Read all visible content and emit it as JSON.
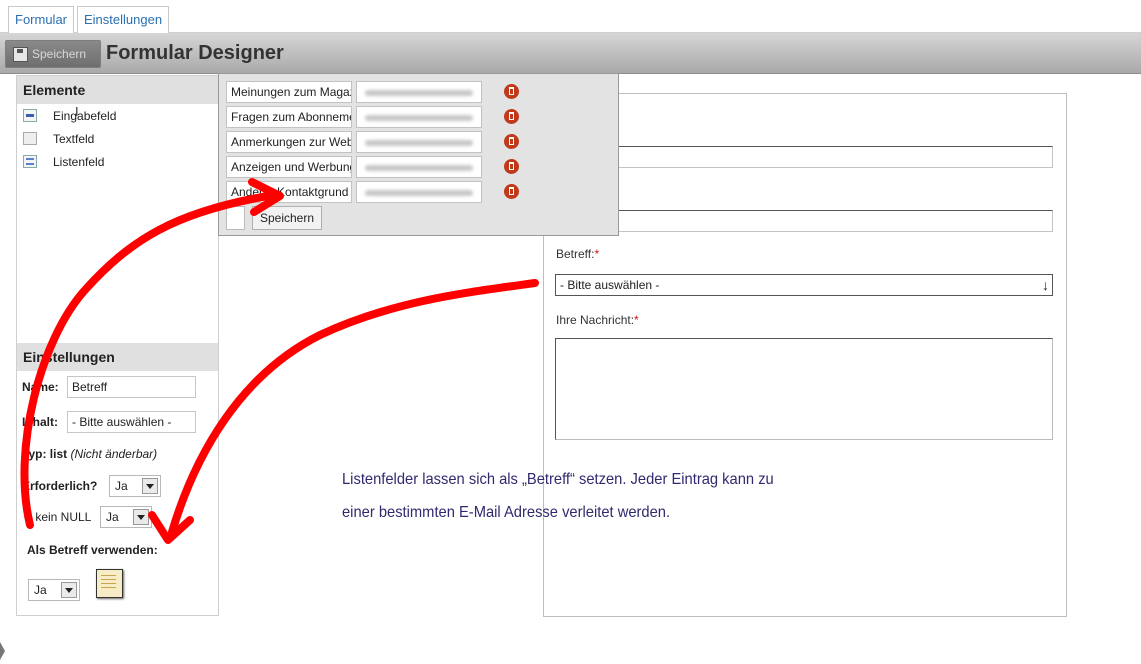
{
  "tabs": [
    {
      "label": "Formular"
    },
    {
      "label": "Einstellungen"
    }
  ],
  "toolbar": {
    "save_label": "Speichern",
    "title": "Formular Designer"
  },
  "elements_panel": {
    "title": "Elemente",
    "items": [
      {
        "label": "Eingabefeld",
        "icon": "input-field-icon"
      },
      {
        "label": "Textfeld",
        "icon": "textarea-icon"
      },
      {
        "label": "Listenfeld",
        "icon": "listbox-icon"
      }
    ]
  },
  "settings_panel": {
    "title": "Einstellungen",
    "name_label": "Name:",
    "name_value": "Betreff",
    "content_label": "Inhalt:",
    "content_value": "- Bitte auswählen -",
    "type_label": "Typ: list",
    "type_note": "(Nicht änderbar)",
    "required_label": "Erforderlich?",
    "required_value": "Ja",
    "notnull_label": "- kein NULL",
    "notnull_value": "Ja",
    "subject_label": "Als Betreff verwenden:",
    "subject_value": "Ja"
  },
  "popup": {
    "rows": [
      {
        "name": "Meinungen zum Magazin"
      },
      {
        "name": "Fragen zum Abonnement"
      },
      {
        "name": "Anmerkungen zur Website"
      },
      {
        "name": "Anzeigen und Werbung"
      },
      {
        "name": "Anderer Kontaktgrund"
      }
    ],
    "save_label": "Speichern"
  },
  "form_preview": {
    "subject_label": "Betreff:",
    "subject_select": "- Bitte auswählen -",
    "message_label": "Ihre Nachricht:",
    "required_mark": "*"
  },
  "caption": {
    "line1": "Listenfelder lassen sich als „Betreff“ setzen. Jeder Eintrag kann zu",
    "line2": "einer bestimmten E-Mail Adresse verleitet werden."
  },
  "colors": {
    "annotation_arrow": "#ff0000",
    "link_blue": "#2a6fb0",
    "caption_text": "#2f2a6e",
    "delete_icon": "#c0391b"
  }
}
